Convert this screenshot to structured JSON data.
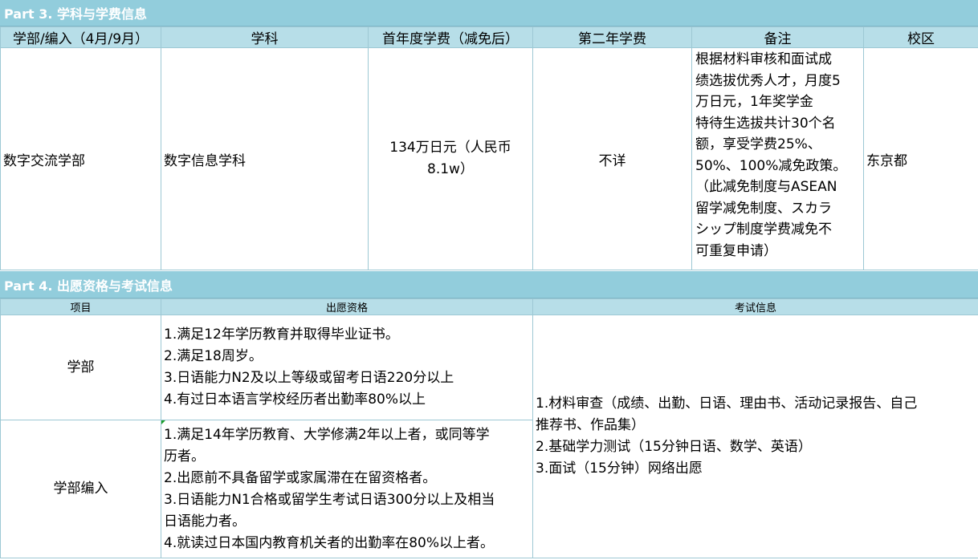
{
  "part3": {
    "title": "Part 3. 学科与学费信息",
    "headers": [
      "学部/编入（4月/9月）",
      "学科",
      "首年度学费（减免后）",
      "第二年学费",
      "备注",
      "校区"
    ],
    "row": {
      "faculty": "数字交流学部",
      "department": "数字信息学科",
      "first_year_fee_lines": [
        "134万日元（人民币",
        "8.1w）"
      ],
      "second_year_fee": "不详",
      "remarks_lines": [
        "根据材料审核和面试成",
        "绩选拔优秀人才，月度5",
        "万日元，1年奖学金",
        "特待生选拔共计30个名",
        "额，享受学费25%、",
        "50%、100%减免政策。",
        "（此减免制度与ASEAN",
        "留学减免制度、スカラ",
        "シップ制度学费减免不",
        "可重复申请）"
      ],
      "campus": "东京都"
    }
  },
  "part4": {
    "title": "Part 4. 出愿资格与考试信息",
    "headers": [
      "项目",
      "出愿资格",
      "考试信息"
    ],
    "rows": [
      {
        "item": "学部",
        "qualification_lines": [
          "1.满足12年学历教育并取得毕业证书。",
          "2.满足18周岁。",
          "3.日语能力N2及以上等级或留考日语220分以上",
          "4.有过日本语言学校经历者出勤率80%以上"
        ]
      },
      {
        "item": "学部编入",
        "qualification_lines": [
          "1.满足14年学历教育、大学修满2年以上者，或同等学",
          "历者。",
          "2.出愿前不具备留学或家属滞在在留资格者。",
          "3.日语能力N1合格或留学生考试日语300分以上及相当",
          "日语能力者。",
          "4.就读过日本国内教育机关者的出勤率在80%以上者。"
        ]
      }
    ],
    "exam_lines": [
      "1.材料审查（成绩、出勤、日语、理由书、活动记录报告、自己",
      "推荐书、作品集）",
      "2.基础学力测试（15分钟日语、数学、英语）",
      "3.面试（15分钟）网络出愿"
    ]
  },
  "colors": {
    "band": "#92CDDC",
    "header": "#B7DEE8",
    "border": "#9dc8d4"
  }
}
